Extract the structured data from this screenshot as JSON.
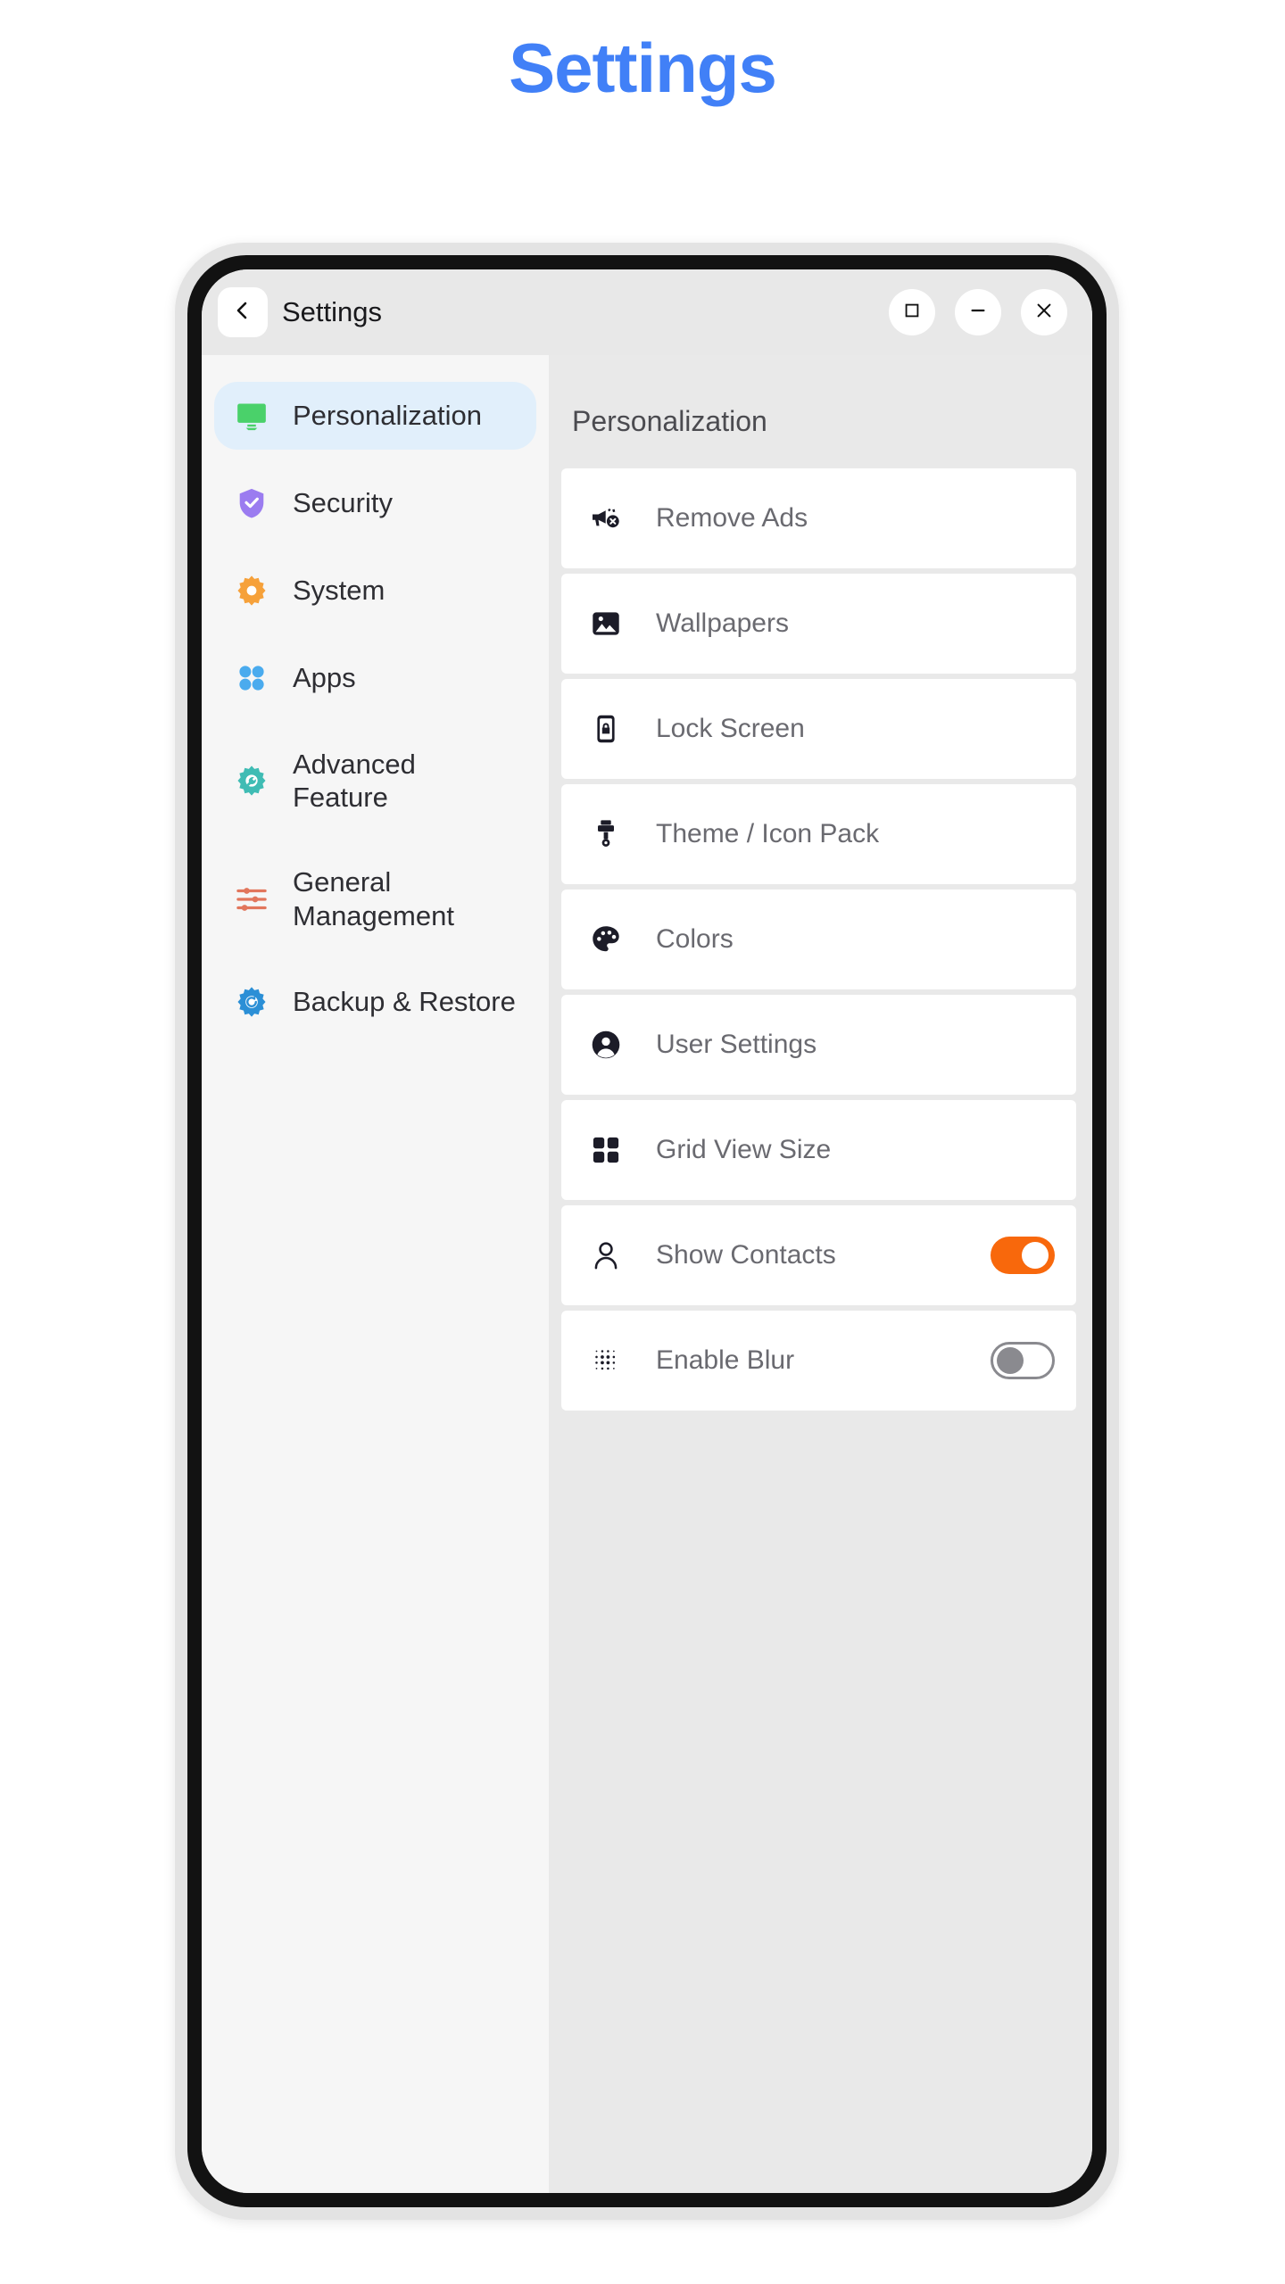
{
  "page": {
    "title": "Settings",
    "title_color": "#4180f7"
  },
  "window": {
    "title": "Settings",
    "back_icon": "chevron-left-icon",
    "controls": [
      {
        "name": "maximize",
        "icon": "square-icon"
      },
      {
        "name": "minimize",
        "icon": "dash-icon"
      },
      {
        "name": "close",
        "icon": "x-icon"
      }
    ]
  },
  "sidebar": {
    "items": [
      {
        "label": "Personalization",
        "icon": "monitor-icon",
        "color": "#4ad16a",
        "active": true
      },
      {
        "label": "Security",
        "icon": "shield-check-icon",
        "color": "#9b7cf0",
        "active": false
      },
      {
        "label": "System",
        "icon": "gear-icon",
        "color": "#f6a13a",
        "active": false
      },
      {
        "label": "Apps",
        "icon": "four-dots-icon",
        "color": "#4aabee",
        "active": false
      },
      {
        "label": "Advanced Feature",
        "icon": "gear-wrench-icon",
        "color": "#3fbcb4",
        "active": false
      },
      {
        "label": "General Management",
        "icon": "sliders-icon",
        "color": "#e2765c",
        "active": false
      },
      {
        "label": "Backup & Restore",
        "icon": "gear-refresh-icon",
        "color": "#2b8fd6",
        "active": false
      }
    ]
  },
  "content": {
    "heading": "Personalization",
    "items": [
      {
        "label": "Remove Ads",
        "icon": "megaphone-off-icon",
        "toggle": null
      },
      {
        "label": "Wallpapers",
        "icon": "image-icon",
        "toggle": null
      },
      {
        "label": "Lock Screen",
        "icon": "phone-lock-icon",
        "toggle": null
      },
      {
        "label": "Theme / Icon Pack",
        "icon": "paintbrush-icon",
        "toggle": null
      },
      {
        "label": "Colors",
        "icon": "palette-icon",
        "toggle": null
      },
      {
        "label": "User Settings",
        "icon": "account-circle-icon",
        "toggle": null
      },
      {
        "label": "Grid View Size",
        "icon": "grid-icon",
        "toggle": null
      },
      {
        "label": "Show Contacts",
        "icon": "person-icon",
        "toggle": "on"
      },
      {
        "label": "Enable Blur",
        "icon": "dot-grid-icon",
        "toggle": "off"
      }
    ]
  },
  "colors": {
    "accent_blue": "#4180f7",
    "toggle_on": "#f8680c",
    "toggle_off": "#8a8a8f",
    "selected_bg": "#e1effb"
  }
}
